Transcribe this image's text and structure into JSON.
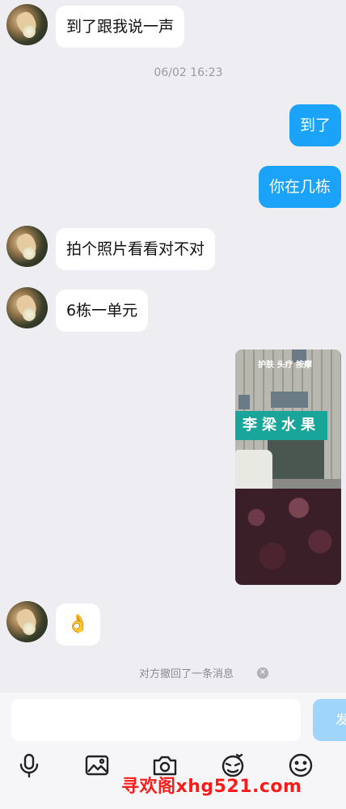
{
  "messages": {
    "m1": "到了跟我说一声",
    "timestamp": "06/02 16:23",
    "m2": "到了",
    "m3": "你在几栋",
    "m4": "拍个照片看看对不对",
    "m5": "6栋一单元",
    "m6": "👌"
  },
  "photo": {
    "shop_sign": "李梁水果",
    "top_sign": "护肤 头疗 按摩"
  },
  "recall_notice": "对方撤回了一条消息",
  "composer": {
    "placeholder": "",
    "send_label": "发送"
  },
  "toolbar": {
    "icons": [
      "microphone-icon",
      "image-icon",
      "camera-icon",
      "sticker-icon",
      "emoji-icon"
    ]
  },
  "watermark": "寻欢阁xhg521.com",
  "colors": {
    "outgoing_bubble": "#1aa3f8",
    "incoming_bubble": "#ffffff",
    "background": "#eeeef2",
    "send_button": "#9fd4fb"
  }
}
